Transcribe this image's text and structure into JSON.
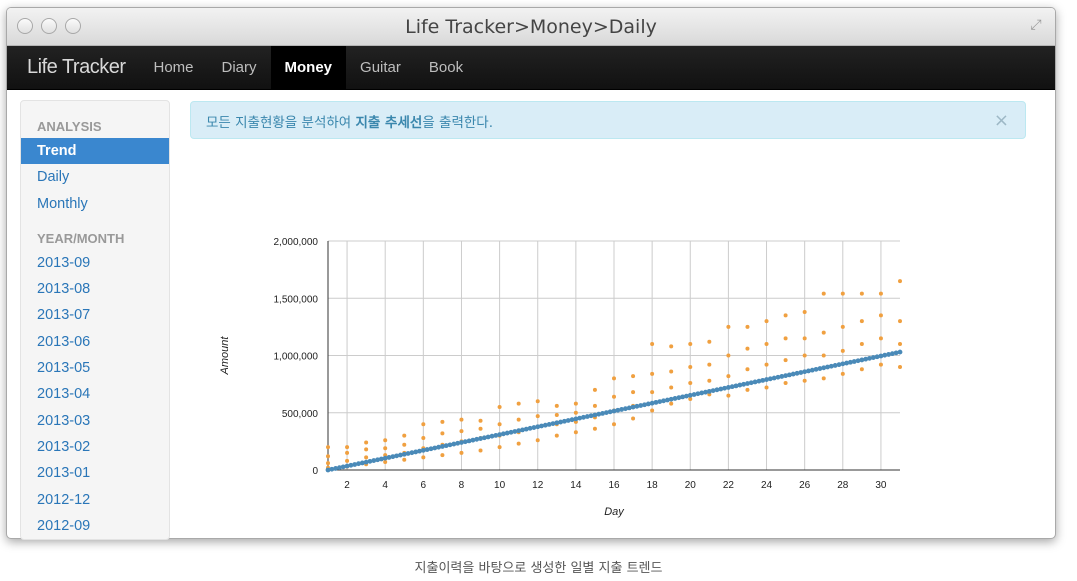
{
  "window": {
    "title": "Life Tracker>Money>Daily"
  },
  "navbar": {
    "brand": "Life Tracker",
    "items": [
      {
        "label": "Home",
        "active": false
      },
      {
        "label": "Diary",
        "active": false
      },
      {
        "label": "Money",
        "active": true
      },
      {
        "label": "Guitar",
        "active": false
      },
      {
        "label": "Book",
        "active": false
      }
    ]
  },
  "sidebar": {
    "analysis_header": "ANALYSIS",
    "analysis_items": [
      {
        "label": "Trend",
        "active": true
      },
      {
        "label": "Daily",
        "active": false
      },
      {
        "label": "Monthly",
        "active": false
      }
    ],
    "yearmonth_header": "YEAR/MONTH",
    "yearmonth_items": [
      "2013-09",
      "2013-08",
      "2013-07",
      "2013-06",
      "2013-05",
      "2013-04",
      "2013-03",
      "2013-02",
      "2013-01",
      "2012-12",
      "2012-09"
    ]
  },
  "alert": {
    "text_before": "모든 지출현황을 분석하여 ",
    "text_bold": "지출 추세선",
    "text_after": "을 출력한다.",
    "close": "×"
  },
  "caption": "지출이력을 바탕으로 생성한 일별 지출 트렌드",
  "colors": {
    "points": "#f0a040",
    "trend": "#4a8ab8",
    "accent": "#3a87cf"
  },
  "chart_data": {
    "type": "scatter",
    "xlabel": "Day",
    "ylabel": "Amount",
    "xlim": [
      1,
      31
    ],
    "ylim": [
      0,
      2000000
    ],
    "xticks": [
      2,
      4,
      6,
      8,
      10,
      12,
      14,
      16,
      18,
      20,
      22,
      24,
      26,
      28,
      30
    ],
    "yticks": [
      0,
      500000,
      1000000,
      1500000,
      2000000
    ],
    "ytick_labels": [
      "0",
      "500,000",
      "1,000,000",
      "1,500,000",
      "2,000,000"
    ],
    "trend": {
      "x": [
        1,
        31
      ],
      "y": [
        0,
        1030000
      ]
    },
    "series": [
      {
        "x": [
          1,
          1,
          1,
          1,
          2,
          2,
          2,
          2,
          3,
          3,
          3,
          3,
          4,
          4,
          4,
          4,
          5,
          5,
          5,
          5,
          6,
          6,
          6,
          6,
          7,
          7,
          7,
          7,
          8,
          8,
          8,
          8,
          9,
          9,
          9,
          9,
          10,
          10,
          10,
          10,
          11,
          11,
          11,
          11,
          12,
          12,
          12,
          12,
          13,
          13,
          13,
          13,
          14,
          14,
          14,
          14,
          15,
          15,
          15,
          15,
          16,
          16,
          16,
          16,
          17,
          17,
          17,
          17,
          18,
          18,
          18,
          18,
          19,
          19,
          19,
          19,
          20,
          20,
          20,
          20,
          21,
          21,
          21,
          21,
          22,
          22,
          22,
          22,
          23,
          23,
          23,
          23,
          24,
          24,
          24,
          24,
          25,
          25,
          25,
          25,
          26,
          26,
          26,
          26,
          27,
          27,
          27,
          27,
          28,
          28,
          28,
          28,
          29,
          29,
          29,
          29,
          30,
          30,
          30,
          30,
          31,
          31,
          31,
          31
        ],
        "y": [
          200000,
          120000,
          60000,
          20000,
          200000,
          150000,
          80000,
          30000,
          240000,
          180000,
          110000,
          50000,
          260000,
          190000,
          130000,
          70000,
          300000,
          220000,
          150000,
          90000,
          400000,
          280000,
          190000,
          110000,
          420000,
          320000,
          220000,
          130000,
          440000,
          340000,
          250000,
          150000,
          430000,
          360000,
          280000,
          170000,
          550000,
          400000,
          300000,
          200000,
          580000,
          440000,
          330000,
          230000,
          600000,
          470000,
          380000,
          260000,
          560000,
          480000,
          400000,
          300000,
          580000,
          500000,
          420000,
          330000,
          700000,
          560000,
          460000,
          360000,
          800000,
          640000,
          520000,
          400000,
          820000,
          680000,
          560000,
          450000,
          1100000,
          840000,
          680000,
          520000,
          1080000,
          860000,
          720000,
          580000,
          1100000,
          900000,
          760000,
          620000,
          1120000,
          920000,
          780000,
          660000,
          1250000,
          1000000,
          820000,
          650000,
          1250000,
          1060000,
          880000,
          700000,
          1300000,
          1100000,
          920000,
          720000,
          1350000,
          1150000,
          960000,
          760000,
          1380000,
          1150000,
          1000000,
          780000,
          1540000,
          1200000,
          1000000,
          800000,
          1540000,
          1250000,
          1040000,
          840000,
          1540000,
          1300000,
          1100000,
          880000,
          1540000,
          1350000,
          1150000,
          920000,
          1650000,
          1300000,
          1100000,
          900000
        ]
      }
    ]
  }
}
